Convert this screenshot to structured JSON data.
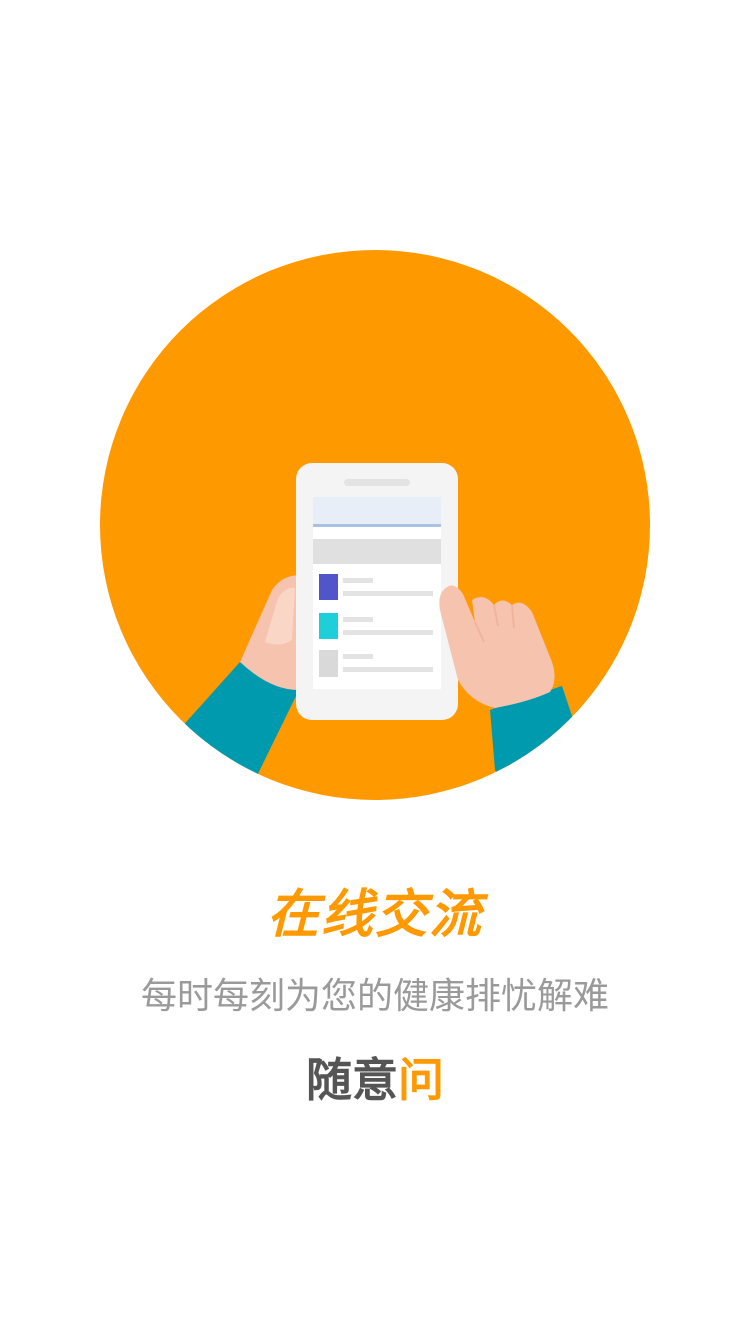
{
  "colors": {
    "accent": "#ff9900",
    "text_gray": "#9a9a9a",
    "text_dark": "#555555",
    "sleeve": "#009aaf",
    "skin": "#f6c3ae",
    "tablet": "#f4f4f4",
    "list_item_1": "#5155c9",
    "list_item_2": "#1ccfd9",
    "list_item_3": "#d9d9d9"
  },
  "hero": {
    "icon": "hands-holding-tablet-illustration"
  },
  "headline": "在线交流",
  "subtitle": "每时每刻为您的健康排忧解难",
  "tagline": {
    "prefix": "随意",
    "highlight": "问"
  }
}
